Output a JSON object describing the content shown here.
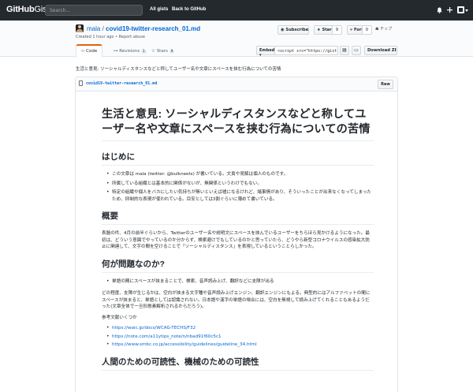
{
  "nav": {
    "logo_main": "GitHub",
    "logo_sub": "Gist",
    "search_placeholder": "Search...",
    "all_gists": "All gists",
    "back": "Back to GitHub"
  },
  "gist": {
    "owner": "mala",
    "separator": "/",
    "filename_title": "covid19-twitter-research_01.md",
    "created": "Created 1 hour ago",
    "report": "Report abuse",
    "subscribe": "Subscribe",
    "star": "Star",
    "star_count": "9",
    "fork": "Fork",
    "fork_count": "0",
    "chip": "チップ",
    "tabs": [
      {
        "label": "Code",
        "count": ""
      },
      {
        "label": "Revisions",
        "count": "1"
      },
      {
        "label": "Stars",
        "count": "9"
      }
    ],
    "embed_label": "Embed",
    "embed_value": "<script src=\"https://gist.github.com/mala/",
    "download": "Download ZIP",
    "description": "生活と意見: ソーシャルディスタンスなどと称してユーザー名や文章にスペースを挟む行為についての苦情"
  },
  "file": {
    "name": "covid19-twitter-research_01.md",
    "raw": "Raw"
  },
  "doc": {
    "h1": "生活と意見: ソーシャルディスタンスなどと称してユーザー名や文章にスペースを挟む行為についての苦情",
    "intro_h": "はじめに",
    "intro_items": [
      "この文章は mala (twitter: @bulkneets) が書いている。文責や見解は個人のものです。",
      "所属している組織とは基本的に関係がないが、無関係というわけでもない。",
      "特定の組織や個人をバカにしたい気持ちが無いといえば嘘になるけれど、諸事情があり、そういったことが出来なくなってしまったため、抑制的な表現が使われている。目安としては3割ぐらいに薄めて書いている。"
    ],
    "overview_h": "概要",
    "overview_p": "表題の件、4月の前半ぐらいから、Twitterのユーザー名や説明文にスペースを挟んでいるユーザーをちらほら見かけるようになった。最初は、どういう意図でやっているのか分からず、検索避けでもしているのかと思っていたら、どうやら新型コロナウイルスの感染拡大防止に関連して、文字の間を空けることで「ソーシャルディスタンス」を表現しているということらしかった。",
    "problem_h": "何が問題なのか?",
    "problem_items": [
      "単語の間にスペースが挟まることで、検索、音声読み上げ、翻訳などに支障が出る"
    ],
    "problem_p": "どの程度、支障が生じるかは、空白が挟まる文字種や音声読み上げエンジン、翻訳エンジンにもよる。典型的にはアルファベットの間にスペースが挟まると、単語としては認識されない。日本語や漢字の単語の場合には、空白を無視して読み上げてくれることもあるようだった(文章全体で一旦形態素解析されるからだろう)。",
    "refs_label": "参考文献いくつか",
    "refs": [
      "https://waic.jp/docs/WCAG-TECHS/F32",
      "https://note.com/a11ytips_note/n/nbad91f60c5c1",
      "https://www.smbc.co.jp/accessibility/guidelines/guideline_34.html"
    ],
    "human_h": "人間のための可読性、機械のための可読性"
  },
  "colors": {
    "nav_bg": "#24292e",
    "link": "#0366d6",
    "active_tab": "#e36209"
  },
  "icons": [
    "bell-icon",
    "plus-icon",
    "avatar-icon",
    "caret-down-icon",
    "code-icon",
    "revisions-icon",
    "star-icon",
    "fork-icon",
    "eye-icon",
    "clipboard-icon",
    "desktop-icon",
    "file-icon"
  ]
}
